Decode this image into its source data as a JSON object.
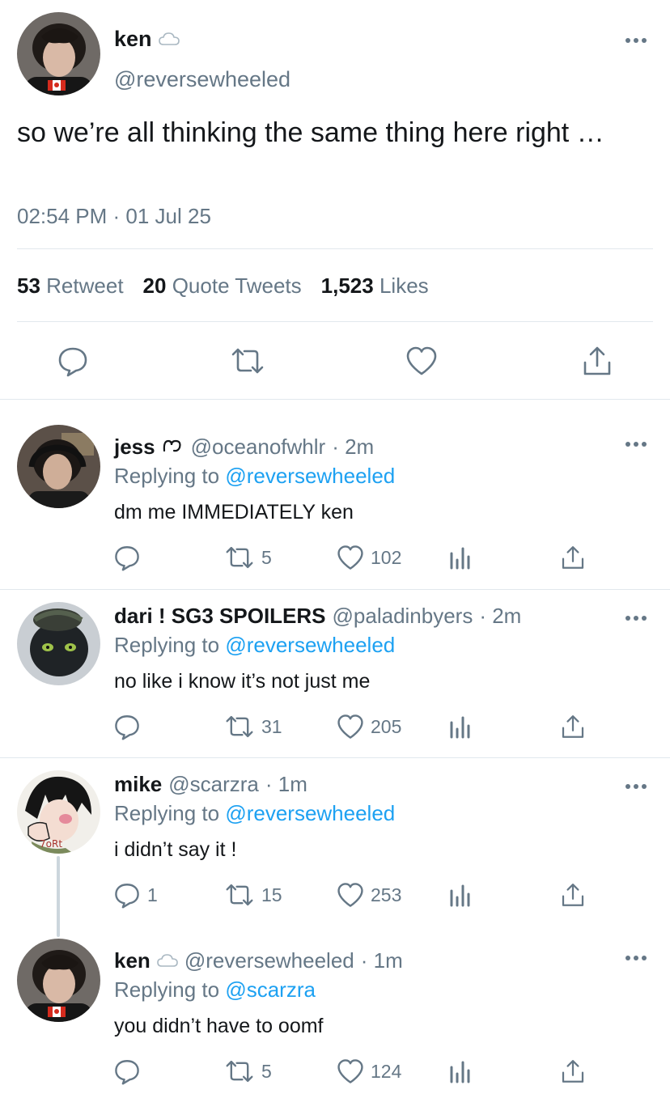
{
  "main_tweet": {
    "name": "ken",
    "handle": "@reversewheeled",
    "text": "so we’re all thinking the same thing here right …",
    "timestamp": "02:54 PM · 01 Jul 25",
    "stats": {
      "retweets_count": "53",
      "retweets_label": "Retweet",
      "quotes_count": "20",
      "quotes_label": "Quote Tweets",
      "likes_count": "1,523",
      "likes_label": "Likes"
    }
  },
  "replies": [
    {
      "name": "jess",
      "handle": "@oceanofwhlr",
      "time": "· 2m",
      "replying_prefix": "Replying to",
      "replying_to": "@reversewheeled",
      "text": "dm me IMMEDIATELY ken",
      "reply_count": "",
      "retweet_count": "5",
      "like_count": "102"
    },
    {
      "name": "dari ! SG3 SPOILERS",
      "handle": "@paladinbyers",
      "time": "· 2m",
      "replying_prefix": "Replying to",
      "replying_to": "@reversewheeled",
      "text": "no like i know it’s not just me",
      "reply_count": "",
      "retweet_count": "31",
      "like_count": "205"
    },
    {
      "name": "mike",
      "handle": "@scarzra",
      "time": "· 1m",
      "replying_prefix": "Replying to",
      "replying_to": "@reversewheeled",
      "text": "i didn’t say it !",
      "reply_count": "1",
      "retweet_count": "15",
      "like_count": "253"
    },
    {
      "name": "ken",
      "handle": "@reversewheeled",
      "time": "· 1m",
      "replying_prefix": "Replying to",
      "replying_to": "@scarzra",
      "text": "you didn’t have to oomf",
      "reply_count": "",
      "retweet_count": "5",
      "like_count": "124"
    }
  ],
  "colors": {
    "text": "#14171a",
    "secondary": "#657786",
    "link": "#1da1f2",
    "divider": "#e1e8ed"
  },
  "icons": [
    "more-icon",
    "cloud-icon",
    "heart-squiggle-icon",
    "reply-icon",
    "retweet-icon",
    "like-icon",
    "share-icon",
    "analytics-icon"
  ]
}
